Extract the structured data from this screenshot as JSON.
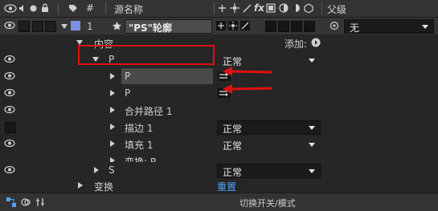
{
  "header": {
    "col_number": "#",
    "col_source_name": "源名称",
    "col_parent": "父级",
    "icon_fx": "fx"
  },
  "layer": {
    "number": "1",
    "name": "\"PS\"轮廓",
    "parent_value": "无"
  },
  "rows": {
    "content_label": "内容",
    "add_label": "添加:",
    "group_p_label": "P",
    "group_p_mode": "正常",
    "path_p1_label": "P",
    "path_p2_label": "P",
    "merge_paths_label": "合并路径 1",
    "stroke_label": "描边 1",
    "stroke_mode": "正常",
    "fill_label": "填充 1",
    "fill_mode": "正常",
    "transform_p_label": "变换: P",
    "group_s_label": "S",
    "group_s_mode": "正常",
    "transform_label": "变换",
    "reset_label": "重置"
  },
  "footer": {
    "toggle_label": "切换开关/模式"
  },
  "colors": {
    "accent_blue": "#4ea3ff",
    "annotation_red": "#e01010",
    "layer_label_color": "#7b8fe0"
  }
}
